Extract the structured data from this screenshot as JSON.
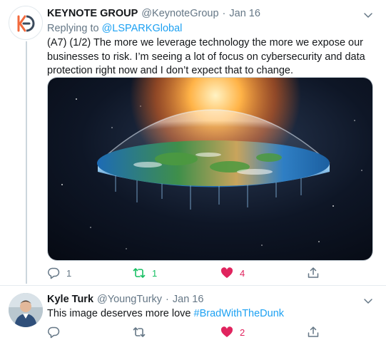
{
  "tweets": [
    {
      "name": "KEYNOTE GROUP",
      "handle": "@KeynoteGroup",
      "separator": "·",
      "date": "Jan 16",
      "replying_prefix": "Replying to ",
      "replying_to": "@LSPARKGlobal",
      "text": "(A7) (1/2) The more we leverage technology the more we expose our businesses to risk. I’m seeing a lot of focus on cybersecurity and data protection right now and I don’t expect that to change.",
      "reply_count": "1",
      "retweet_count": "1",
      "like_count": "4",
      "avatar_icon": "keynote-group-logo",
      "brand_color": "#f26a3d"
    },
    {
      "name": "Kyle Turk",
      "handle": "@YoungTurky",
      "separator": "·",
      "date": "Jan 16",
      "text": "This image deserves more love ",
      "hashtag": "#BradWithTheDunk",
      "reply_count": "",
      "retweet_count": "",
      "like_count": "2"
    }
  ],
  "colors": {
    "link": "#1da1f2",
    "like": "#e0245e",
    "retweet": "#17bf63",
    "muted": "#657786"
  }
}
